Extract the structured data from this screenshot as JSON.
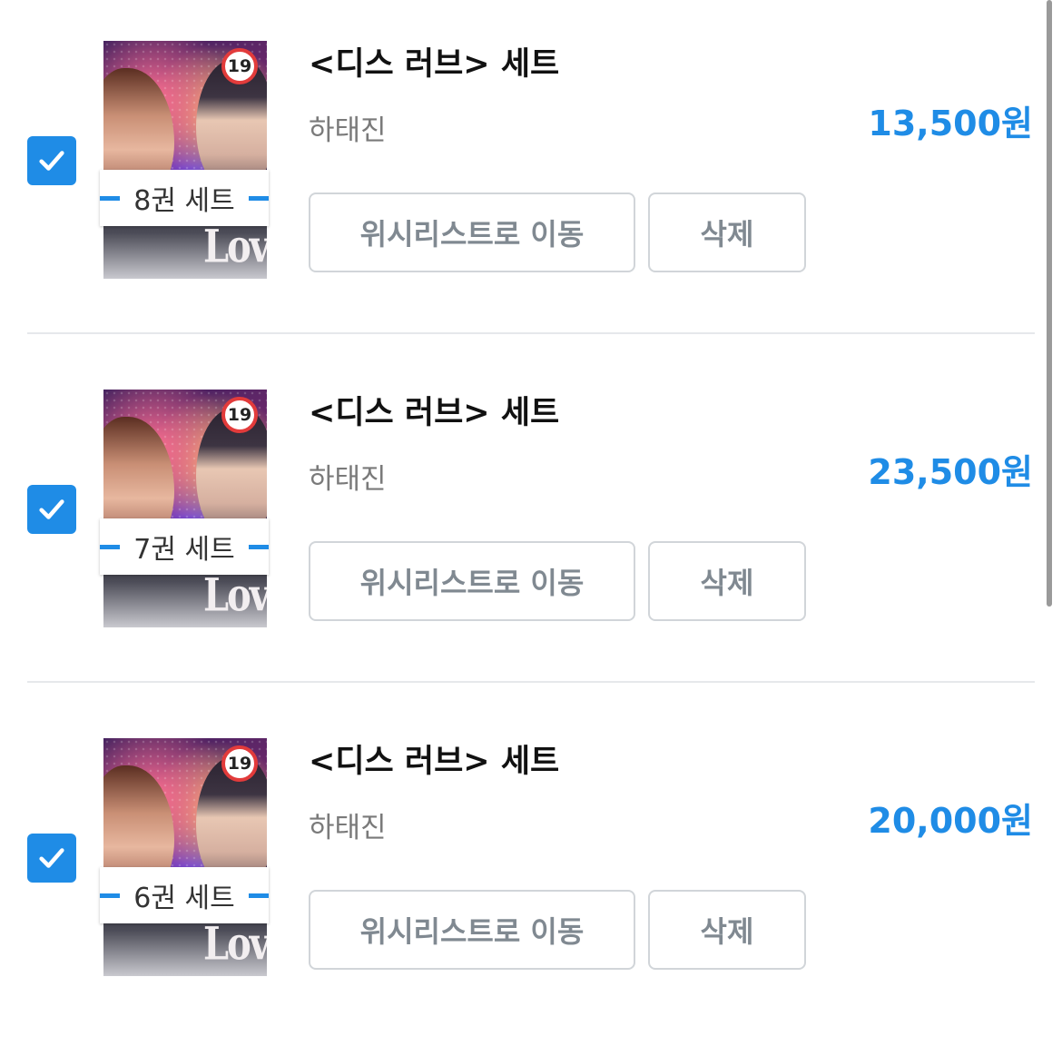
{
  "cart": {
    "items": [
      {
        "title": "<디스 러브> 세트",
        "author": "하태진",
        "price": "13,500원",
        "set_badge": "8권 세트",
        "age_rating": "19",
        "cover_logo": "Love",
        "checked": true,
        "wishlist_label": "위시리스트로 이동",
        "delete_label": "삭제"
      },
      {
        "title": "<디스 러브> 세트",
        "author": "하태진",
        "price": "23,500원",
        "set_badge": "7권 세트",
        "age_rating": "19",
        "cover_logo": "Love",
        "checked": true,
        "wishlist_label": "위시리스트로 이동",
        "delete_label": "삭제"
      },
      {
        "title": "<디스 러브> 세트",
        "author": "하태진",
        "price": "20,000원",
        "set_badge": "6권 세트",
        "age_rating": "19",
        "cover_logo": "Love",
        "checked": true,
        "wishlist_label": "위시리스트로 이동",
        "delete_label": "삭제"
      }
    ]
  },
  "colors": {
    "accent": "#1f8ce6",
    "title": "#111111",
    "author": "#7a7a7a",
    "button_text": "#808991",
    "button_border": "#d1d5d9",
    "divider": "#e6e8eb"
  },
  "icons": {
    "checkbox": "checkmark-icon",
    "age_rating": "age-19-icon"
  }
}
